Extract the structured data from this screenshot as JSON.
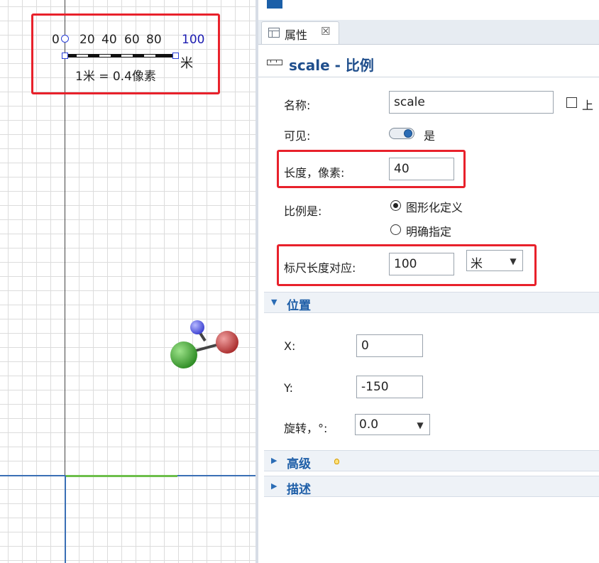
{
  "canvas": {
    "scale_ticks": [
      "0",
      "20",
      "40",
      "60",
      "80",
      "100"
    ],
    "scale_unit": "米",
    "scale_ratio": "1米 = 0.4像素"
  },
  "panel": {
    "tab": {
      "label": "属性",
      "close": "☒"
    },
    "title": "scale - 比例",
    "fields": {
      "name_label": "名称:",
      "name_value": "scale",
      "top_checkbox_label": "上",
      "visible_label": "可见:",
      "visible_value": "是",
      "length_label": "长度，像素:",
      "length_value": "40",
      "scale_is_label": "比例是:",
      "scale_option_graphic": "图形化定义",
      "scale_option_explicit": "明确指定",
      "ruler_label": "标尺长度对应:",
      "ruler_value": "100",
      "ruler_unit": "米"
    },
    "position": {
      "section_label": "位置",
      "x_label": "X:",
      "x_value": "0",
      "y_label": "Y:",
      "y_value": "-150",
      "rotation_label": "旋转，°:",
      "rotation_value": "0.0"
    },
    "advanced_label": "高级",
    "description_label": "描述"
  },
  "colors": {
    "highlight_box": "#e8212b",
    "title_blue": "#1f4e8c",
    "section_blue": "#1f5fa8",
    "end_tick_blue": "#1a1ab0"
  },
  "icons": {
    "tab": "properties-table-icon",
    "title": "ruler-icon",
    "advanced_hint": "lightbulb-icon"
  }
}
